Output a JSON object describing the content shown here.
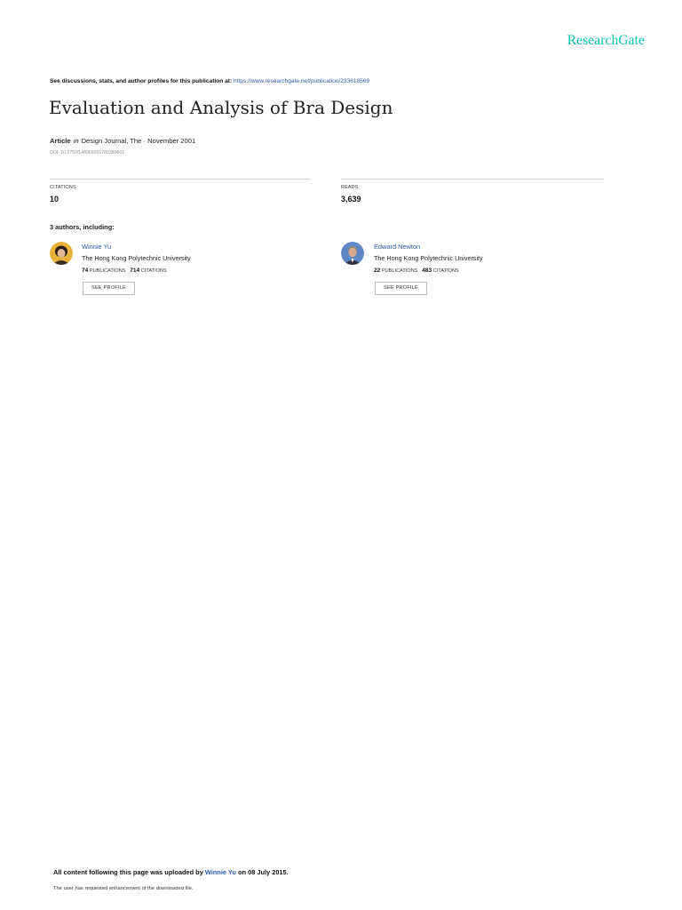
{
  "brand": {
    "name": "ResearchGate"
  },
  "discussion": {
    "label": "See discussions, stats, and author profiles for this publication at:",
    "url": "https://www.researchgate.net/publication/233618569"
  },
  "publication": {
    "title": "Evaluation and Analysis of Bra Design",
    "type": "Article",
    "in_word": "in",
    "journal": "Design Journal, The",
    "date": "November 2001",
    "doi": "DOI: 10.2752/146069201789389601"
  },
  "stats": {
    "citations_label": "CITATIONS",
    "citations_value": "10",
    "reads_label": "READS",
    "reads_value": "3,639"
  },
  "authors_heading": "3 authors, including:",
  "authors": [
    {
      "name": "Winnie Yu",
      "institution": "The Hong Kong Polytechnic University",
      "publications_count": "74",
      "publications_label": "PUBLICATIONS",
      "citations_count": "714",
      "citations_label": "CITATIONS",
      "button": "SEE PROFILE"
    },
    {
      "name": "Edward Newton",
      "institution": "The Hong Kong Polytechnic University",
      "publications_count": "22",
      "publications_label": "PUBLICATIONS",
      "citations_count": "483",
      "citations_label": "CITATIONS",
      "button": "SEE PROFILE"
    }
  ],
  "footer": {
    "lead": "All content following this page was uploaded by",
    "uploader": "Winnie Yu",
    "date_text": "on 08 July 2015.",
    "note": "The user has requested enhancement of the downloaded file."
  },
  "colors": {
    "brand": "#00c5a8",
    "link": "#2a5db0"
  }
}
